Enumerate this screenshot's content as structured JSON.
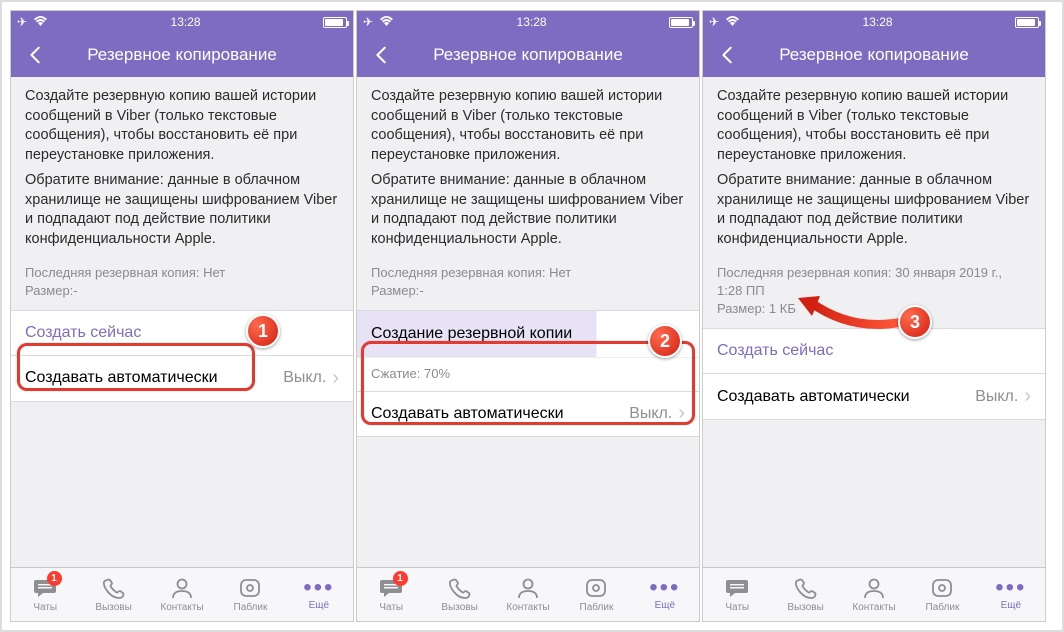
{
  "status": {
    "time": "13:28"
  },
  "header": {
    "title": "Резервное копирование"
  },
  "body": {
    "description": "Создайте резервную копию вашей истории сообщений в Viber (только текстовые сообщения), чтобы восстановить её при переустановке приложения.",
    "notice": "Обратите внимание: данные в облачном хранилище не защищены шифрованием Viber и подпадают под действие политики конфиденциальности Apple."
  },
  "meta1": {
    "line1": "Последняя резервная копия: Нет",
    "line2": "Размер:-"
  },
  "meta3": {
    "line1": "Последняя резервная копия: 30 января 2019 г.,",
    "line2": "1:28 ПП",
    "line3": "Размер: 1 КБ"
  },
  "buttons": {
    "create_now": "Создать сейчас",
    "creating": "Создание резервной копии",
    "compression": "Сжатие: 70%",
    "auto_create": "Создавать автоматически",
    "auto_value": "Выкл."
  },
  "tabs": {
    "chats": "Чаты",
    "calls": "Вызовы",
    "contacts": "Контакты",
    "public": "Паблик",
    "more": "Ещё",
    "badge": "1"
  },
  "markers": {
    "m1": "1",
    "m2": "2",
    "m3": "3"
  }
}
